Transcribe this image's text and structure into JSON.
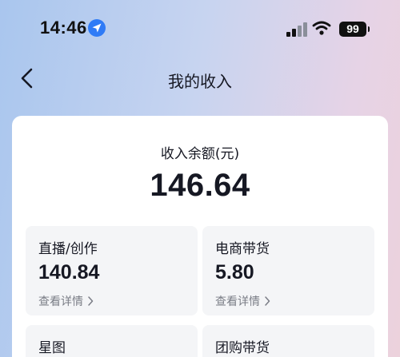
{
  "status_bar": {
    "time": "14:46",
    "battery": "99",
    "icons": [
      "location-arrow-icon",
      "signal-icon",
      "wifi-icon",
      "battery-icon"
    ]
  },
  "nav": {
    "title": "我的收入",
    "back_icon": "chevron-left-icon"
  },
  "balance": {
    "label": "收入余额(元)",
    "value": "146.64"
  },
  "tiles": [
    {
      "label": "直播/创作",
      "value": "140.84",
      "link": "查看详情"
    },
    {
      "label": "电商带货",
      "value": "5.80",
      "link": "查看详情"
    },
    {
      "label": "星图",
      "value": "",
      "link": ""
    },
    {
      "label": "团购带货",
      "value": "",
      "link": ""
    }
  ],
  "colors": {
    "accent_blue": "#2f7bf6",
    "card_bg": "#ffffff",
    "tile_bg": "#f4f5f7",
    "text_primary": "#161823",
    "text_secondary": "#7a7d86"
  }
}
